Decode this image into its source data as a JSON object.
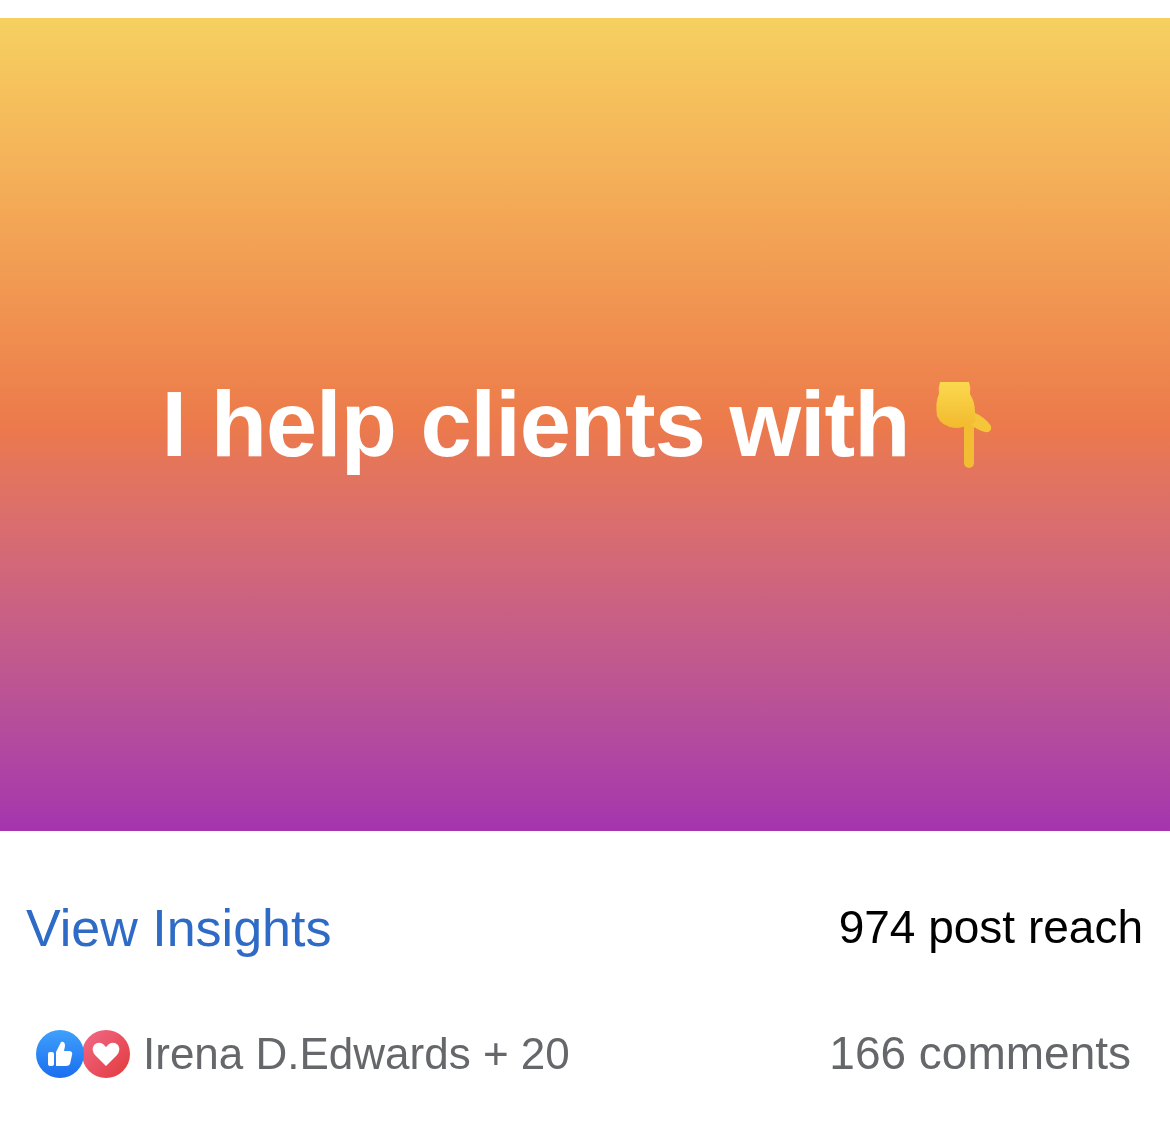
{
  "post": {
    "text": "I help clients with"
  },
  "insights": {
    "link": "View Insights",
    "reach": "974 post reach"
  },
  "reactions": {
    "icons": [
      {
        "kind": "like"
      },
      {
        "kind": "love"
      }
    ],
    "summary": "Irena D.Edwards + 20",
    "comments": "166 comments"
  }
}
